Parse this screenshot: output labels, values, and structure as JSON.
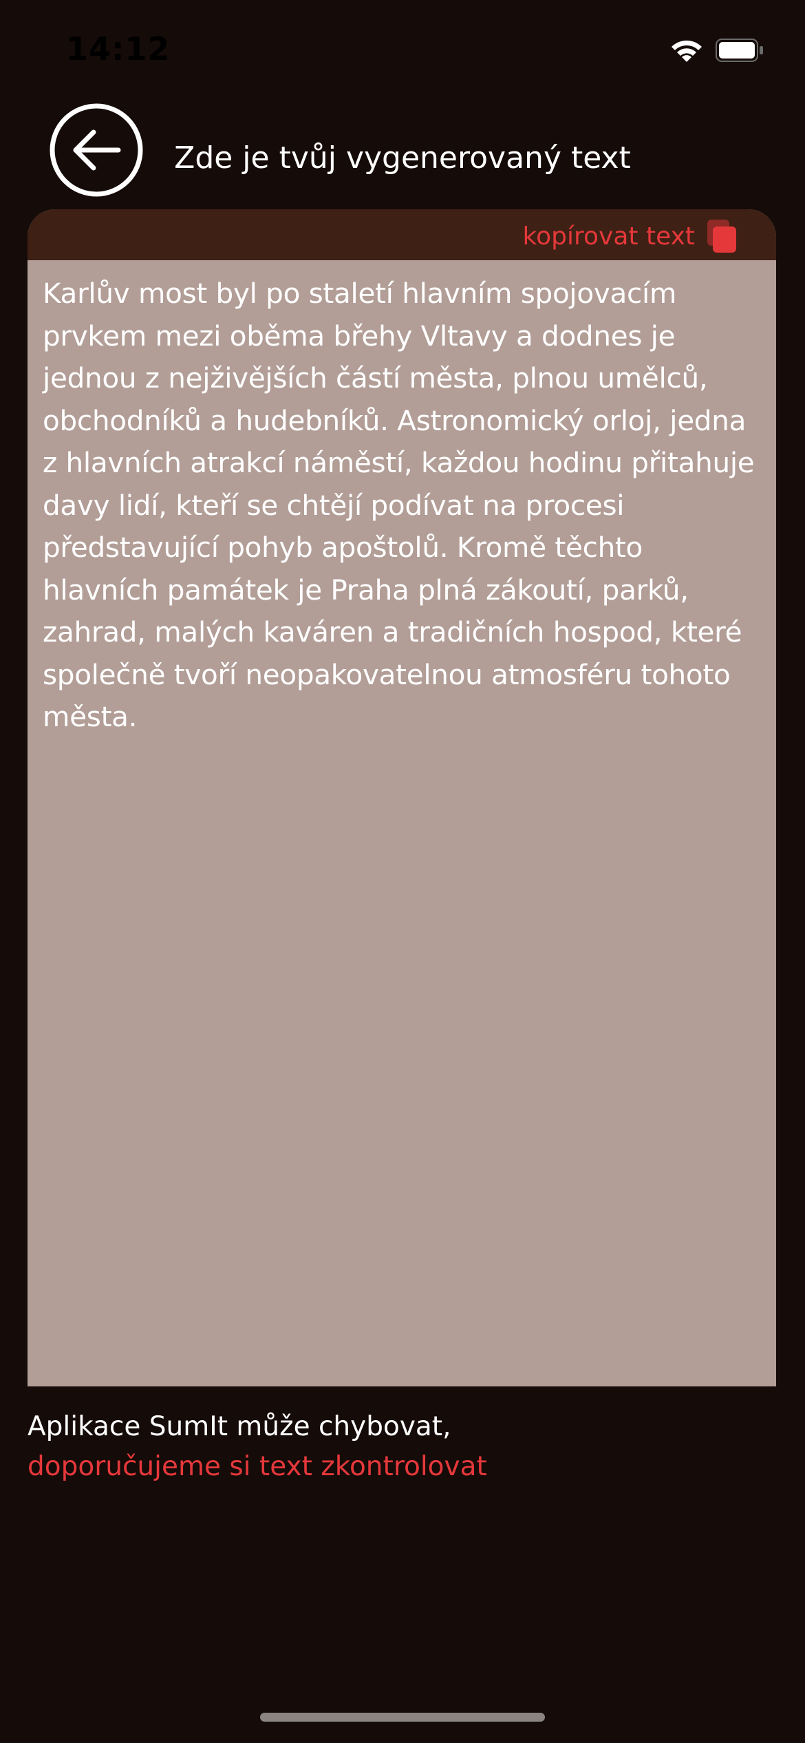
{
  "status_bar": {
    "time": "14:12"
  },
  "header": {
    "back_icon": "arrow-left-circle-icon",
    "title": "Zde je tvůj vygenerovaný text"
  },
  "card": {
    "copy_label": "kopírovat text",
    "copy_icon": "copy-icon",
    "text": "Karlův most byl po staletí hlavním spojovacím prvkem mezi oběma břehy Vltavy a dodnes je jednou z nejživějších částí města, plnou umělců, obchodníků a hudebníků. Astronomický orloj, jedna z hlavních atrakcí náměstí, každou hodinu přitahuje davy lidí, kteří se chtějí podívat na procesi představující pohyb apoštolů. Kromě těchto hlavních památek je Praha plná zákoutí, parků, zahrad, malých kaváren a tradičních hospod, které společně tvoří neopakovatelnou atmosféru tohoto města."
  },
  "footer": {
    "disclaimer_line1": "Aplikace SumIt může chybovat,",
    "disclaimer_line2": "doporučujeme si text zkontrolovat"
  },
  "colors": {
    "background": "#150b08",
    "card_background": "#b29e97",
    "toolbar_background": "#3e2014",
    "accent": "#e5383b"
  }
}
